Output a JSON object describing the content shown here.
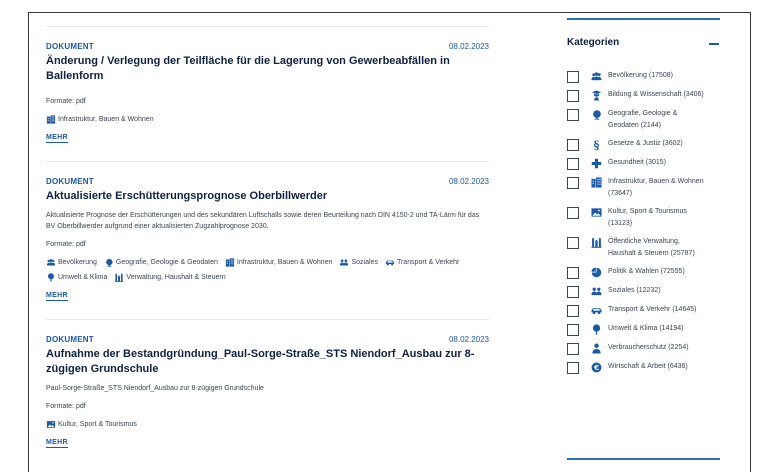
{
  "theme": {
    "accent": "#1c5aa8",
    "title": "#0f2142",
    "text": "#3a4556",
    "rule": "#2f6cba"
  },
  "results": [
    {
      "type": "DOKUMENT",
      "date": "08.02.2023",
      "title": "Änderung / Verlegung der Teilfläche für die Lagerung von Gewerbeabfällen in Ballenform",
      "description": "",
      "formats": "Formate: pdf",
      "tags": [
        {
          "icon": "building-icon",
          "label": "Infrastruktur, Bauen & Wohnen"
        }
      ],
      "more": "MEHR"
    },
    {
      "type": "DOKUMENT",
      "date": "08.02.2023",
      "title": "Aktualisierte Erschütterungsprognose Oberbillwerder",
      "description": "Aktualisierte Prognose der Erschütterungen und des sekundären Luftschalls sowie deren Beurteilung nach DIN 4150-2 und TA-Lärm für das BV Oberbillwerder aufgrund einer aktualisierten Zugzahlprognose 2030.",
      "formats": "Formate: pdf",
      "tags": [
        {
          "icon": "people-icon",
          "label": "Bevölkerung"
        },
        {
          "icon": "globe-icon",
          "label": "Geografie, Geologie & Geodaten"
        },
        {
          "icon": "building-icon",
          "label": "Infrastruktur, Bauen & Wohnen"
        },
        {
          "icon": "group-icon",
          "label": "Soziales"
        },
        {
          "icon": "car-icon",
          "label": "Transport & Verkehr"
        },
        {
          "icon": "tree-icon",
          "label": "Umwelt & Klima"
        },
        {
          "icon": "townhall-icon",
          "label": "Verwaltung, Haushalt & Steuern"
        }
      ],
      "more": "MEHR"
    },
    {
      "type": "DOKUMENT",
      "date": "08.02.2023",
      "title": "Aufnahme der Bestandgründung_Paul-Sorge-Straße_STS Niendorf_Ausbau zur 8-zügigen Grundschule",
      "description": "Paul-Sorge-Straße_STS Niendorf_Ausbau zur 8-zügigen Grundschule",
      "formats": "Formate: pdf",
      "tags": [
        {
          "icon": "picture-icon",
          "label": "Kultur, Sport & Tourismus"
        }
      ],
      "more": "MEHR"
    }
  ],
  "sidebar": {
    "title": "Kategorien",
    "categories": [
      {
        "icon": "people-icon",
        "label": "Bevölkerung (17508)",
        "checked": false
      },
      {
        "icon": "graduate-icon",
        "label": "Bildung & Wissenschaft (3406)",
        "checked": false
      },
      {
        "icon": "globe-icon",
        "label": "Geografie, Geologie & Geodaten (2144)",
        "checked": false
      },
      {
        "icon": "paragraph-icon",
        "label": "Gesetze & Justiz (3602)",
        "checked": false
      },
      {
        "icon": "health-cross-icon",
        "label": "Gesundheit (3015)",
        "checked": false
      },
      {
        "icon": "building-icon",
        "label": "Infrastruktur, Bauen & Wohnen (73647)",
        "checked": false
      },
      {
        "icon": "picture-icon",
        "label": "Kultur, Sport & Tourismus (13123)",
        "checked": false
      },
      {
        "icon": "townhall-icon",
        "label": "Öffentliche Verwaltung, Haushalt & Steuern (25787)",
        "checked": false
      },
      {
        "icon": "pie-chart-icon",
        "label": "Politik & Wahlen (72555)",
        "checked": false
      },
      {
        "icon": "group-icon",
        "label": "Soziales (12232)",
        "checked": false
      },
      {
        "icon": "car-icon",
        "label": "Transport & Verkehr (14645)",
        "checked": false
      },
      {
        "icon": "tree-icon",
        "label": "Umwelt & Klima (14194)",
        "checked": false
      },
      {
        "icon": "person-icon",
        "label": "Verbraucherschutz (2254)",
        "checked": false
      },
      {
        "icon": "euro-icon",
        "label": "Wirtschaft & Arbeit (6436)",
        "checked": false
      }
    ]
  }
}
